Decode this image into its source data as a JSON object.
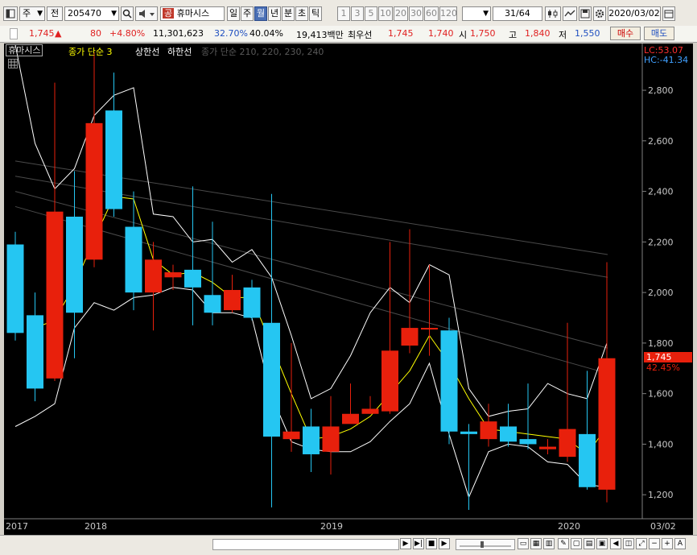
{
  "toolbar": {
    "period_select": "주",
    "prev_label": "전",
    "stock_code": "205470",
    "market_badge": "공",
    "stock_name": "휴마시스",
    "tabs": [
      "일",
      "주",
      "월",
      "년",
      "분",
      "초",
      "틱"
    ],
    "active_tab": "월",
    "intervals": [
      "1",
      "3",
      "5",
      "10",
      "20",
      "30",
      "60",
      "120"
    ],
    "count": "31",
    "count_total": "/64",
    "date": "2020/03/02"
  },
  "quote": {
    "price": "1,745",
    "change_arrow": "▲",
    "change": "80",
    "change_pct": "+4.80%",
    "volume": "11,301,623",
    "vol_ratio": "32.70%",
    "turnover_pct": "40.04%",
    "amount": "19,413백만",
    "ask_label": "최우선",
    "ask": "1,745",
    "bid": "1,740",
    "open_label": "시",
    "open": "1,750",
    "high_label": "고",
    "high": "1,840",
    "low_label": "저",
    "low": "1,550",
    "buy_label": "매수",
    "sell_label": "매도"
  },
  "chart_header": {
    "stock_tag": "휴마시스",
    "legend_ma3": "종가 단순 3",
    "legend_upper": "상한선",
    "legend_lower": "하한선",
    "legend_long_ma": "종가 단순 210, 220, 230, 240",
    "lc_label": "LC:53.07",
    "hc_label": "HC:-41.34",
    "price_flag": "1,745",
    "price_flag_pct": "42.45%"
  },
  "x_labels": [
    "2017",
    "2018",
    "2019",
    "2020",
    "03/02"
  ],
  "colors": {
    "up": "#e8200c",
    "down": "#25c6f2",
    "ma": "#ffff00",
    "band": "#ffffff",
    "long_ma": "#4a4a4a",
    "axis_text": "#c8c8c8"
  },
  "chart_data": {
    "type": "candlestick",
    "y_axis": {
      "ticks": [
        1200,
        1400,
        1600,
        1800,
        2000,
        2200,
        2400,
        2600,
        2800
      ],
      "range": [
        1105,
        2985
      ]
    },
    "candles": [
      {
        "o": 2190,
        "c": 1840,
        "h": 2240,
        "l": 1810
      },
      {
        "o": 1910,
        "c": 1620,
        "h": 2000,
        "l": 1570
      },
      {
        "o": 1660,
        "c": 2320,
        "h": 2830,
        "l": 1650
      },
      {
        "o": 2300,
        "c": 1920,
        "h": 2480,
        "l": 1740
      },
      {
        "o": 2130,
        "c": 2670,
        "h": 2950,
        "l": 2100
      },
      {
        "o": 2720,
        "c": 2330,
        "h": 2870,
        "l": 2300
      },
      {
        "o": 2260,
        "c": 2000,
        "h": 2400,
        "l": 1930
      },
      {
        "o": 2000,
        "c": 2130,
        "h": 2200,
        "l": 1850
      },
      {
        "o": 2060,
        "c": 2080,
        "h": 2110,
        "l": 2010
      },
      {
        "o": 2090,
        "c": 2020,
        "h": 2420,
        "l": 1870
      },
      {
        "o": 1990,
        "c": 1920,
        "h": 2280,
        "l": 1870
      },
      {
        "o": 1930,
        "c": 2010,
        "h": 2070,
        "l": 1920
      },
      {
        "o": 2020,
        "c": 1900,
        "h": 2050,
        "l": 1890
      },
      {
        "o": 1880,
        "c": 1430,
        "h": 2390,
        "l": 1150
      },
      {
        "o": 1420,
        "c": 1450,
        "h": 1800,
        "l": 1370
      },
      {
        "o": 1470,
        "c": 1360,
        "h": 1540,
        "l": 1290
      },
      {
        "o": 1370,
        "c": 1470,
        "h": 1590,
        "l": 1280
      },
      {
        "o": 1480,
        "c": 1520,
        "h": 1640,
        "l": 1490
      },
      {
        "o": 1520,
        "c": 1540,
        "h": 1590,
        "l": 1520
      },
      {
        "o": 1530,
        "c": 1770,
        "h": 2200,
        "l": 1520
      },
      {
        "o": 1790,
        "c": 1860,
        "h": 2250,
        "l": 1760
      },
      {
        "o": 1860,
        "c": 1860,
        "h": 2110,
        "l": 1750
      },
      {
        "o": 1850,
        "c": 1450,
        "h": 1900,
        "l": 1400
      },
      {
        "o": 1450,
        "c": 1440,
        "h": 1480,
        "l": 1140
      },
      {
        "o": 1420,
        "c": 1490,
        "h": 1560,
        "l": 1390
      },
      {
        "o": 1470,
        "c": 1410,
        "h": 1560,
        "l": 1390
      },
      {
        "o": 1420,
        "c": 1400,
        "h": 1640,
        "l": 1380
      },
      {
        "o": 1380,
        "c": 1390,
        "h": 1420,
        "l": 1360
      },
      {
        "o": 1350,
        "c": 1460,
        "h": 1880,
        "l": 1330
      },
      {
        "o": 1440,
        "c": 1230,
        "h": 1690,
        "l": 1220
      },
      {
        "o": 1220,
        "c": 1740,
        "h": 2120,
        "l": 1170
      }
    ],
    "ma3": [
      null,
      1860,
      1890,
      2030,
      2210,
      2380,
      2370,
      2130,
      2070,
      2080,
      2040,
      1980,
      1980,
      1790,
      1600,
      1420,
      1430,
      1460,
      1510,
      1600,
      1690,
      1830,
      1720,
      1580,
      1460,
      1450,
      1440,
      1430,
      1420,
      1360,
      1470
    ],
    "upper_band": [
      2980,
      2590,
      2410,
      2490,
      2700,
      2780,
      2810,
      2310,
      2300,
      2200,
      2210,
      2120,
      2170,
      2060,
      1830,
      1580,
      1620,
      1750,
      1920,
      2020,
      1960,
      2110,
      2070,
      1620,
      1510,
      1530,
      1540,
      1640,
      1600,
      1580,
      1800
    ],
    "lower_band": [
      1470,
      1510,
      1560,
      1860,
      1960,
      1930,
      1980,
      1990,
      2020,
      2010,
      1920,
      1920,
      1900,
      1590,
      1410,
      1380,
      1370,
      1370,
      1410,
      1490,
      1560,
      1720,
      1440,
      1190,
      1370,
      1400,
      1390,
      1330,
      1320,
      1240,
      1230
    ],
    "long_ma": [
      {
        "from": 2520,
        "to": 2150
      },
      {
        "from": 2460,
        "to": 2060
      },
      {
        "from": 2400,
        "to": 1780
      },
      {
        "from": 2340,
        "to": 1680
      }
    ]
  }
}
